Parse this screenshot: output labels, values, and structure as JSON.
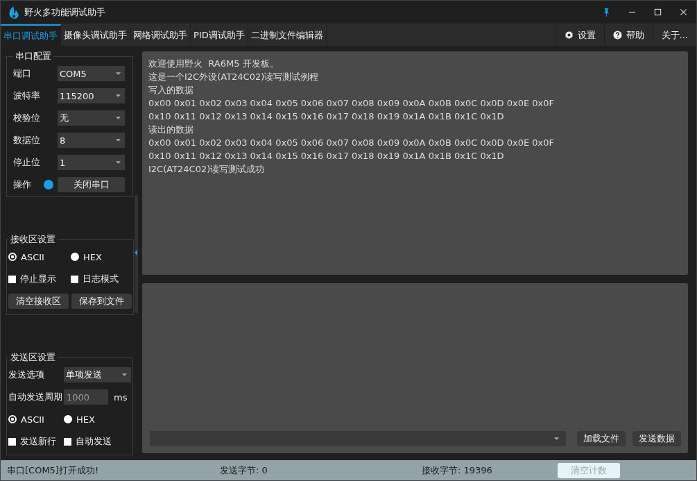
{
  "window": {
    "title": "野火多功能调试助手"
  },
  "tabs": [
    {
      "label": "串口调试助手",
      "selected": true
    },
    {
      "label": "摄像头调试助手",
      "selected": false
    },
    {
      "label": "网络调试助手",
      "selected": false
    },
    {
      "label": "PID调试助手",
      "selected": false
    },
    {
      "label": "二进制文件编辑器",
      "selected": false
    }
  ],
  "toolbar": [
    {
      "kind": "settings",
      "label": "设置"
    },
    {
      "kind": "help",
      "label": "帮助"
    },
    {
      "kind": "plain",
      "label": "关于..."
    }
  ],
  "serial_config": {
    "title": "串口配置",
    "fields": [
      {
        "label": "端口",
        "value": "COM5"
      },
      {
        "label": "波特率",
        "value": "115200"
      },
      {
        "label": "校验位",
        "value": "无"
      },
      {
        "label": "数据位",
        "value": "8"
      },
      {
        "label": "停止位",
        "value": "1"
      }
    ],
    "operation": {
      "label": "操作",
      "connected": true,
      "button": "关闭串口"
    }
  },
  "receive_settings": {
    "title": "接收区设置",
    "radios": [
      {
        "label": "ASCII",
        "selected": true
      },
      {
        "label": "HEX",
        "selected": false
      }
    ],
    "checkboxes": [
      {
        "label": "停止显示",
        "checked": false
      },
      {
        "label": "日志模式",
        "checked": false
      }
    ],
    "buttons": [
      "清空接收区",
      "保存到文件"
    ]
  },
  "send_settings": {
    "title": "发送区设置",
    "option": {
      "label": "发送选项",
      "value": "单项发送"
    },
    "period": {
      "label": "自动发送周期",
      "value": "1000",
      "disabled": true,
      "unit": "ms"
    },
    "radios": [
      {
        "label": "ASCII",
        "selected": true
      },
      {
        "label": "HEX",
        "selected": false
      }
    ],
    "checkboxes": [
      {
        "label": "发送新行",
        "checked": false
      },
      {
        "label": "自动发送",
        "checked": false
      }
    ]
  },
  "receive_text": [
    "欢迎使用野火  RA6M5 开发板。",
    "这是一个I2C外设(AT24C02)读写测试例程",
    "写入的数据",
    "0x00 0x01 0x02 0x03 0x04 0x05 0x06 0x07 0x08 0x09 0x0A 0x0B 0x0C 0x0D 0x0E 0x0F",
    "0x10 0x11 0x12 0x13 0x14 0x15 0x16 0x17 0x18 0x19 0x1A 0x1B 0x1C 0x1D",
    "读出的数据",
    "0x00 0x01 0x02 0x03 0x04 0x05 0x06 0x07 0x08 0x09 0x0A 0x0B 0x0C 0x0D 0x0E 0x0F",
    "0x10 0x11 0x12 0x13 0x14 0x15 0x16 0x17 0x18 0x19 0x1A 0x1B 0x1C 0x1D",
    "I2C(AT24C02)读写测试成功"
  ],
  "send_panel": {
    "buttons": [
      "加载文件",
      "发送数据"
    ]
  },
  "status_bar": {
    "message": "串口[COM5]打开成功!",
    "sent": "发送字节: 0",
    "received": "接收字节: 19396",
    "button": {
      "label": "清空计数",
      "disabled": true
    }
  }
}
